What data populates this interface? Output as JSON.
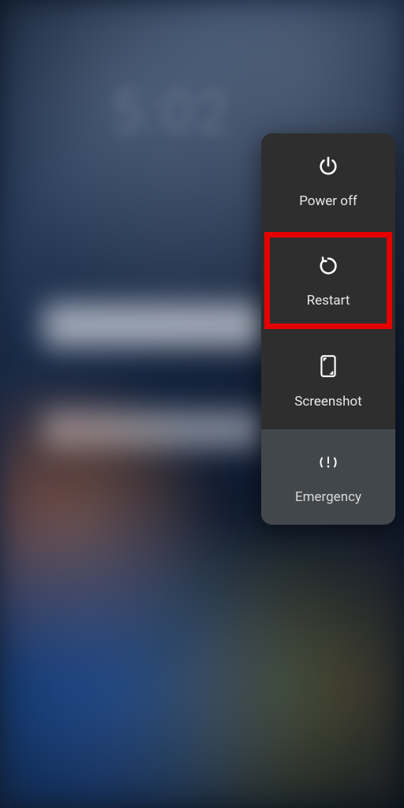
{
  "power_menu": {
    "items": [
      {
        "label": "Power off",
        "highlighted": false
      },
      {
        "label": "Restart",
        "highlighted": true
      },
      {
        "label": "Screenshot",
        "highlighted": false
      },
      {
        "label": "Emergency",
        "highlighted": false
      }
    ]
  }
}
